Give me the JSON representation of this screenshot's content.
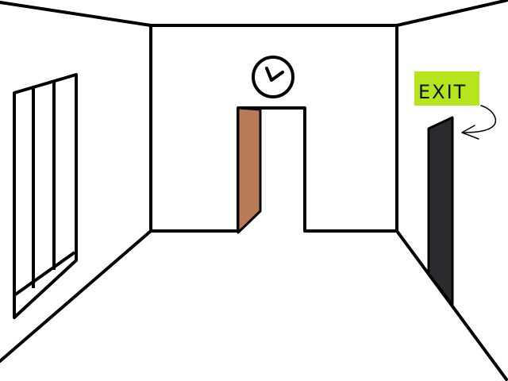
{
  "scene": {
    "exit_sign": {
      "label": "EXIT",
      "background_color": "#b5e61d"
    },
    "colors": {
      "wall": "#ffffff",
      "outline": "#000000",
      "open_door": "#b97a57",
      "exit_door": "#2b2b2f"
    },
    "icons": [
      "wall-clock-icon",
      "curved-arrow-left-icon"
    ]
  }
}
